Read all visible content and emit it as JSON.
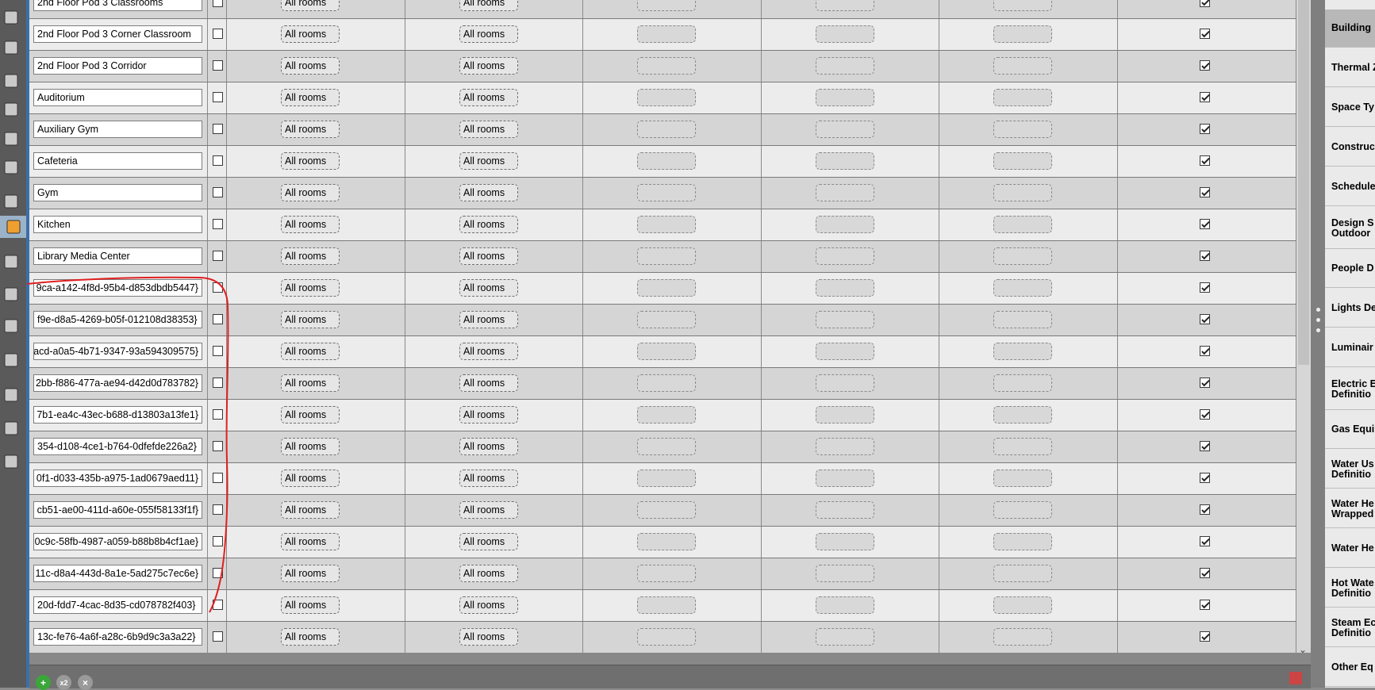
{
  "rows": [
    {
      "name": "2nd Floor Pod 3 Classrooms",
      "clipped": false
    },
    {
      "name": "2nd Floor Pod 3 Corner Classroom",
      "clipped": false
    },
    {
      "name": "2nd Floor Pod 3 Corridor",
      "clipped": false
    },
    {
      "name": "Auditorium",
      "clipped": false
    },
    {
      "name": "Auxiliary Gym",
      "clipped": false
    },
    {
      "name": "Cafeteria",
      "clipped": false
    },
    {
      "name": "Gym",
      "clipped": false
    },
    {
      "name": "Kitchen",
      "clipped": false
    },
    {
      "name": "Library Media Center",
      "clipped": false
    },
    {
      "name": "9ca-a142-4f8d-95b4-d853dbdb5447}",
      "clipped": true
    },
    {
      "name": "f9e-d8a5-4269-b05f-012108d38353}",
      "clipped": true
    },
    {
      "name": "acd-a0a5-4b71-9347-93a594309575}",
      "clipped": true
    },
    {
      "name": "2bb-f886-477a-ae94-d42d0d783782}",
      "clipped": true
    },
    {
      "name": "7b1-ea4c-43ec-b688-d13803a13fe1}",
      "clipped": true
    },
    {
      "name": "354-d108-4ce1-b764-0dfefde226a2}",
      "clipped": true
    },
    {
      "name": "0f1-d033-435b-a975-1ad0679aed11}",
      "clipped": true
    },
    {
      "name": "cb51-ae00-411d-a60e-055f58133f1f}",
      "clipped": true
    },
    {
      "name": "0c9c-58fb-4987-a059-b88b8b4cf1ae}",
      "clipped": true
    },
    {
      "name": "11c-d8a4-443d-8a1e-5ad275c7ec6e}",
      "clipped": true
    },
    {
      "name": "20d-fdd7-4cac-8d35-cd078782f403}",
      "clipped": true
    },
    {
      "name": "13c-fe76-4a6f-a28c-6b9d9c3a3a22}",
      "clipped": true
    }
  ],
  "drop_label": "All rooms",
  "right_panel": {
    "items": [
      {
        "label": "Building",
        "active": true
      },
      {
        "label": "Thermal Z",
        "active": false
      },
      {
        "label": "Space Ty",
        "active": false
      },
      {
        "label": "Construc",
        "active": false
      },
      {
        "label": "Schedule",
        "active": false
      },
      {
        "label": "Design S\nOutdoor",
        "active": false
      },
      {
        "label": "People D",
        "active": false
      },
      {
        "label": "Lights De",
        "active": false
      },
      {
        "label": "Luminair",
        "active": false
      },
      {
        "label": "Electric E\nDefinitio",
        "active": false
      },
      {
        "label": "Gas Equi",
        "active": false
      },
      {
        "label": "Water Us\nDefinitio",
        "active": false
      },
      {
        "label": "Water He\nWrapped",
        "active": false
      },
      {
        "label": "Water He",
        "active": false
      },
      {
        "label": "Hot Wate\nDefinitio",
        "active": false
      },
      {
        "label": "Steam Ec\nDefinitio",
        "active": false
      },
      {
        "label": "Other Eq",
        "active": false
      }
    ]
  },
  "bottom_bar": {
    "add_icon": "plus-circle-icon",
    "copy_label": "x2",
    "remove_icon": "close-circle-icon",
    "purge_icon": "purge-icon"
  },
  "colors": {
    "accent_blue": "#3c6fa8",
    "annotation_red": "#e02020",
    "add_green": "#3aa63a"
  }
}
